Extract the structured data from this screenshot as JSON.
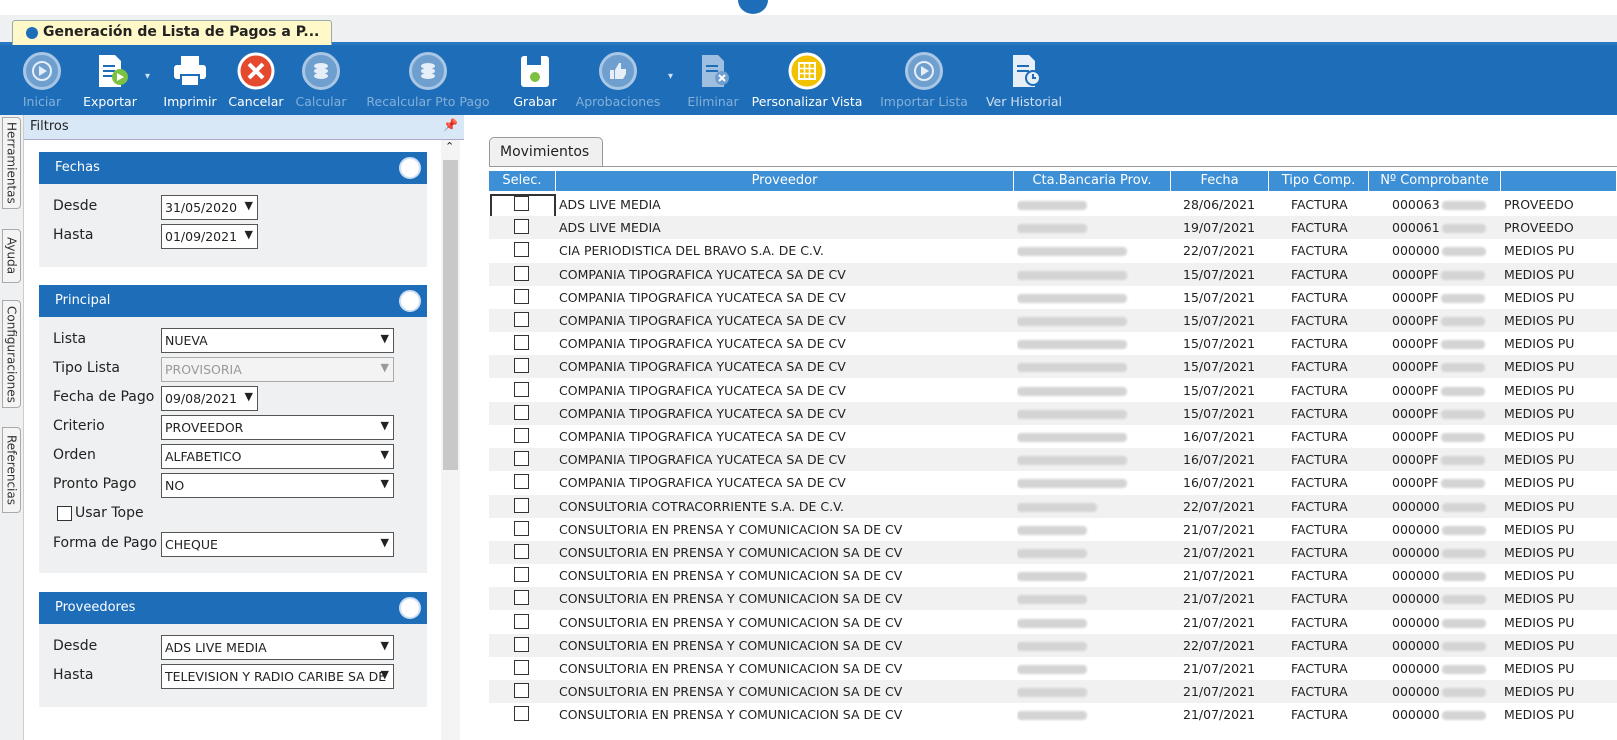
{
  "window_tab": {
    "title": "Generación de Lista de Pagos a P..."
  },
  "toolbar": {
    "buttons": [
      {
        "label": "Iniciar",
        "icon": "play-icon",
        "enabled": false
      },
      {
        "label": "Exportar",
        "icon": "export-icon",
        "enabled": true
      },
      {
        "label": "Imprimir",
        "icon": "printer-icon",
        "enabled": true
      },
      {
        "label": "Cancelar",
        "icon": "cancel-icon",
        "enabled": true
      },
      {
        "label": "Calcular",
        "icon": "coins-icon",
        "enabled": false
      },
      {
        "label": "Recalcular Pto Pago",
        "icon": "coins-icon",
        "enabled": false
      },
      {
        "label": "Grabar",
        "icon": "save-icon",
        "enabled": true
      },
      {
        "label": "Aprobaciones",
        "icon": "thumbs-up-icon",
        "enabled": false
      },
      {
        "label": "Eliminar",
        "icon": "delete-doc-icon",
        "enabled": false
      },
      {
        "label": "Personalizar Vista",
        "icon": "grid-view-icon",
        "enabled": true
      },
      {
        "label": "Importar Lista",
        "icon": "play-icon",
        "enabled": false
      },
      {
        "label": "Ver Historial",
        "icon": "history-doc-icon",
        "enabled": true
      }
    ]
  },
  "side_tabs": [
    "Herramientas",
    "Ayuda",
    "Configuraciones",
    "Referencias"
  ],
  "filters": {
    "title": "Filtros",
    "fechas": {
      "title": "Fechas",
      "desde_label": "Desde",
      "desde": "31/05/2020",
      "hasta_label": "Hasta",
      "hasta": "01/09/2021"
    },
    "principal": {
      "title": "Principal",
      "lista_label": "Lista",
      "lista": "NUEVA",
      "tipo_lista_label": "Tipo Lista",
      "tipo_lista": "PROVISORIA",
      "fecha_pago_label": "Fecha de Pago",
      "fecha_pago": "09/08/2021",
      "criterio_label": "Criterio",
      "criterio": "PROVEEDOR",
      "orden_label": "Orden",
      "orden": "ALFABETICO",
      "pronto_pago_label": "Pronto Pago",
      "pronto_pago": "NO",
      "usar_tope_label": "Usar Tope",
      "forma_pago_label": "Forma de Pago",
      "forma_pago": "CHEQUE"
    },
    "proveedores": {
      "title": "Proveedores",
      "desde_label": "Desde",
      "desde": "ADS LIVE MEDIA",
      "hasta_label": "Hasta",
      "hasta": "TELEVISION Y RADIO CARIBE SA DE"
    }
  },
  "grid": {
    "tab": "Movimientos",
    "columns": [
      "Selec.",
      "Proveedor",
      "Cta.Bancaria Prov.",
      "Fecha",
      "Tipo Comp.",
      "Nº Comprobante",
      ""
    ],
    "rows": [
      {
        "proveedor": "ADS LIVE MEDIA",
        "fecha": "28/06/2021",
        "tipo": "FACTURA",
        "comp": "000063",
        "extra": "PROVEEDO"
      },
      {
        "proveedor": "ADS LIVE MEDIA",
        "fecha": "19/07/2021",
        "tipo": "FACTURA",
        "comp": "000061",
        "extra": "PROVEEDO"
      },
      {
        "proveedor": "CIA PERIODISTICA DEL BRAVO S.A. DE C.V.",
        "fecha": "22/07/2021",
        "tipo": "FACTURA",
        "comp": "000000",
        "extra": "MEDIOS PU"
      },
      {
        "proveedor": "COMPANIA TIPOGRAFICA YUCATECA SA DE CV",
        "fecha": "15/07/2021",
        "tipo": "FACTURA",
        "comp": "0000PF",
        "extra": "MEDIOS PU"
      },
      {
        "proveedor": "COMPANIA TIPOGRAFICA YUCATECA SA DE CV",
        "fecha": "15/07/2021",
        "tipo": "FACTURA",
        "comp": "0000PF",
        "extra": "MEDIOS PU"
      },
      {
        "proveedor": "COMPANIA TIPOGRAFICA YUCATECA SA DE CV",
        "fecha": "15/07/2021",
        "tipo": "FACTURA",
        "comp": "0000PF",
        "extra": "MEDIOS PU"
      },
      {
        "proveedor": "COMPANIA TIPOGRAFICA YUCATECA SA DE CV",
        "fecha": "15/07/2021",
        "tipo": "FACTURA",
        "comp": "0000PF",
        "extra": "MEDIOS PU"
      },
      {
        "proveedor": "COMPANIA TIPOGRAFICA YUCATECA SA DE CV",
        "fecha": "15/07/2021",
        "tipo": "FACTURA",
        "comp": "0000PF",
        "extra": "MEDIOS PU"
      },
      {
        "proveedor": "COMPANIA TIPOGRAFICA YUCATECA SA DE CV",
        "fecha": "15/07/2021",
        "tipo": "FACTURA",
        "comp": "0000PF",
        "extra": "MEDIOS PU"
      },
      {
        "proveedor": "COMPANIA TIPOGRAFICA YUCATECA SA DE CV",
        "fecha": "15/07/2021",
        "tipo": "FACTURA",
        "comp": "0000PF",
        "extra": "MEDIOS PU"
      },
      {
        "proveedor": "COMPANIA TIPOGRAFICA YUCATECA SA DE CV",
        "fecha": "16/07/2021",
        "tipo": "FACTURA",
        "comp": "0000PF",
        "extra": "MEDIOS PU"
      },
      {
        "proveedor": "COMPANIA TIPOGRAFICA YUCATECA SA DE CV",
        "fecha": "16/07/2021",
        "tipo": "FACTURA",
        "comp": "0000PF",
        "extra": "MEDIOS PU"
      },
      {
        "proveedor": "COMPANIA TIPOGRAFICA YUCATECA SA DE CV",
        "fecha": "16/07/2021",
        "tipo": "FACTURA",
        "comp": "0000PF",
        "extra": "MEDIOS PU"
      },
      {
        "proveedor": "CONSULTORIA COTRACORRIENTE S.A. DE C.V.",
        "fecha": "22/07/2021",
        "tipo": "FACTURA",
        "comp": "000000",
        "extra": "MEDIOS PU"
      },
      {
        "proveedor": "CONSULTORIA EN PRENSA Y COMUNICACION SA DE CV",
        "fecha": "21/07/2021",
        "tipo": "FACTURA",
        "comp": "000000",
        "extra": "MEDIOS PU"
      },
      {
        "proveedor": "CONSULTORIA EN PRENSA Y COMUNICACION SA DE CV",
        "fecha": "21/07/2021",
        "tipo": "FACTURA",
        "comp": "000000",
        "extra": "MEDIOS PU"
      },
      {
        "proveedor": "CONSULTORIA EN PRENSA Y COMUNICACION SA DE CV",
        "fecha": "21/07/2021",
        "tipo": "FACTURA",
        "comp": "000000",
        "extra": "MEDIOS PU"
      },
      {
        "proveedor": "CONSULTORIA EN PRENSA Y COMUNICACION SA DE CV",
        "fecha": "21/07/2021",
        "tipo": "FACTURA",
        "comp": "000000",
        "extra": "MEDIOS PU"
      },
      {
        "proveedor": "CONSULTORIA EN PRENSA Y COMUNICACION SA DE CV",
        "fecha": "21/07/2021",
        "tipo": "FACTURA",
        "comp": "000000",
        "extra": "MEDIOS PU"
      },
      {
        "proveedor": "CONSULTORIA EN PRENSA Y COMUNICACION SA DE CV",
        "fecha": "22/07/2021",
        "tipo": "FACTURA",
        "comp": "000000",
        "extra": "MEDIOS PU"
      },
      {
        "proveedor": "CONSULTORIA EN PRENSA Y COMUNICACION SA DE CV",
        "fecha": "21/07/2021",
        "tipo": "FACTURA",
        "comp": "000000",
        "extra": "MEDIOS PU"
      },
      {
        "proveedor": "CONSULTORIA EN PRENSA Y COMUNICACION SA DE CV",
        "fecha": "21/07/2021",
        "tipo": "FACTURA",
        "comp": "000000",
        "extra": "MEDIOS PU"
      },
      {
        "proveedor": "CONSULTORIA EN PRENSA Y COMUNICACION SA DE CV",
        "fecha": "21/07/2021",
        "tipo": "FACTURA",
        "comp": "000000",
        "extra": "MEDIOS PU"
      }
    ]
  },
  "colors": {
    "toolbar": "#1e6db8",
    "header": "#3d8fd6",
    "tab_active": "#fff8c8"
  }
}
